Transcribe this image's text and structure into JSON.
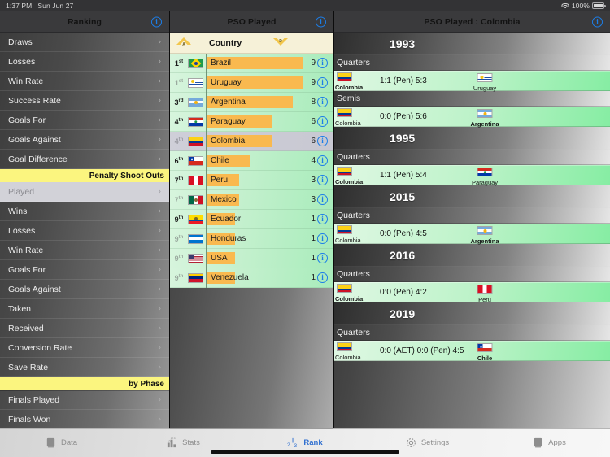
{
  "statusbar": {
    "time": "1:37 PM",
    "date": "Sun Jun 27",
    "battery": "100%"
  },
  "sidebar": {
    "title": "Ranking",
    "info_label": "i",
    "items": [
      {
        "label": "Draws",
        "type": "item",
        "selected": false
      },
      {
        "label": "Losses",
        "type": "item",
        "selected": false
      },
      {
        "label": "Win Rate",
        "type": "item",
        "selected": false
      },
      {
        "label": "Success Rate",
        "type": "item",
        "selected": false
      },
      {
        "label": "Goals For",
        "type": "item",
        "selected": false
      },
      {
        "label": "Goals Against",
        "type": "item",
        "selected": false
      },
      {
        "label": "Goal Difference",
        "type": "item",
        "selected": false
      },
      {
        "label": "Penalty Shoot Outs",
        "type": "header"
      },
      {
        "label": "Played",
        "type": "item",
        "selected": true
      },
      {
        "label": "Wins",
        "type": "item",
        "selected": false
      },
      {
        "label": "Losses",
        "type": "item",
        "selected": false
      },
      {
        "label": "Win Rate",
        "type": "item",
        "selected": false
      },
      {
        "label": "Goals For",
        "type": "item",
        "selected": false
      },
      {
        "label": "Goals Against",
        "type": "item",
        "selected": false
      },
      {
        "label": "Taken",
        "type": "item",
        "selected": false
      },
      {
        "label": "Received",
        "type": "item",
        "selected": false
      },
      {
        "label": "Conversion Rate",
        "type": "item",
        "selected": false
      },
      {
        "label": "Save Rate",
        "type": "item",
        "selected": false
      },
      {
        "label": "by Phase",
        "type": "header"
      },
      {
        "label": "Finals Played",
        "type": "item",
        "selected": false
      },
      {
        "label": "Finals Won",
        "type": "item",
        "selected": false
      }
    ],
    "chevron": "›"
  },
  "ranking": {
    "title": "PSO Played",
    "info_label": "i",
    "column_header": "Country",
    "sort_asc_label": "A",
    "sort_desc_label": "D",
    "max_value": 9,
    "rows": [
      {
        "rank": "1",
        "suffix": "st",
        "country": "Brazil",
        "value": 9,
        "selected": false,
        "dim": false
      },
      {
        "rank": "1",
        "suffix": "st",
        "country": "Uruguay",
        "value": 9,
        "selected": false,
        "dim": true
      },
      {
        "rank": "3",
        "suffix": "rd",
        "country": "Argentina",
        "value": 8,
        "selected": false,
        "dim": false
      },
      {
        "rank": "4",
        "suffix": "th",
        "country": "Paraguay",
        "value": 6,
        "selected": false,
        "dim": false
      },
      {
        "rank": "4",
        "suffix": "th",
        "country": "Colombia",
        "value": 6,
        "selected": true,
        "dim": true
      },
      {
        "rank": "6",
        "suffix": "th",
        "country": "Chile",
        "value": 4,
        "selected": false,
        "dim": false
      },
      {
        "rank": "7",
        "suffix": "th",
        "country": "Peru",
        "value": 3,
        "selected": false,
        "dim": false
      },
      {
        "rank": "7",
        "suffix": "th",
        "country": "Mexico",
        "value": 3,
        "selected": false,
        "dim": true
      },
      {
        "rank": "9",
        "suffix": "th",
        "country": "Ecuador",
        "value": 1,
        "selected": false,
        "dim": false
      },
      {
        "rank": "9",
        "suffix": "th",
        "country": "Honduras",
        "value": 1,
        "selected": false,
        "dim": true
      },
      {
        "rank": "9",
        "suffix": "th",
        "country": "USA",
        "value": 1,
        "selected": false,
        "dim": true
      },
      {
        "rank": "9",
        "suffix": "th",
        "country": "Venezuela",
        "value": 1,
        "selected": false,
        "dim": true
      }
    ]
  },
  "detail": {
    "title": "PSO Played : Colombia",
    "info_label": "i",
    "groups": [
      {
        "year": "1993",
        "phases": [
          {
            "phase": "Quarters",
            "matches": [
              {
                "home": "Colombia",
                "away": "Uruguay",
                "score": "1:1  (Pen) 5:3",
                "winner": "home"
              }
            ]
          },
          {
            "phase": "Semis",
            "matches": [
              {
                "home": "Colombia",
                "away": "Argentina",
                "score": "0:0  (Pen) 5:6",
                "winner": "away"
              }
            ]
          }
        ]
      },
      {
        "year": "1995",
        "phases": [
          {
            "phase": "Quarters",
            "matches": [
              {
                "home": "Colombia",
                "away": "Paraguay",
                "score": "1:1  (Pen) 5:4",
                "winner": "home"
              }
            ]
          }
        ]
      },
      {
        "year": "2015",
        "phases": [
          {
            "phase": "Quarters",
            "matches": [
              {
                "home": "Colombia",
                "away": "Argentina",
                "score": "0:0  (Pen) 4:5",
                "winner": "away"
              }
            ]
          }
        ]
      },
      {
        "year": "2016",
        "phases": [
          {
            "phase": "Quarters",
            "matches": [
              {
                "home": "Colombia",
                "away": "Peru",
                "score": "0:0  (Pen) 4:2",
                "winner": "home"
              }
            ]
          }
        ]
      },
      {
        "year": "2019",
        "phases": [
          {
            "phase": "Quarters",
            "matches": [
              {
                "home": "Colombia",
                "away": "Chile",
                "score": "0:0  (AET) 0:0  (Pen) 4:5",
                "winner": "away"
              }
            ]
          }
        ]
      }
    ]
  },
  "tabbar": {
    "items": [
      {
        "label": "Data",
        "icon": "data-icon",
        "active": false
      },
      {
        "label": "Stats",
        "icon": "stats-icon",
        "active": false
      },
      {
        "label": "Rank",
        "icon": "rank-icon",
        "active": true
      },
      {
        "label": "Settings",
        "icon": "gear-icon",
        "active": false
      },
      {
        "label": "Apps",
        "icon": "apps-icon",
        "active": false
      }
    ]
  },
  "colors": {
    "accent": "#1c7ee8",
    "header_yellow": "#fbf57f",
    "bar_orange": "#f9b94f",
    "row_green": "#b9f2c6",
    "active_tab": "#2f6fd0"
  }
}
